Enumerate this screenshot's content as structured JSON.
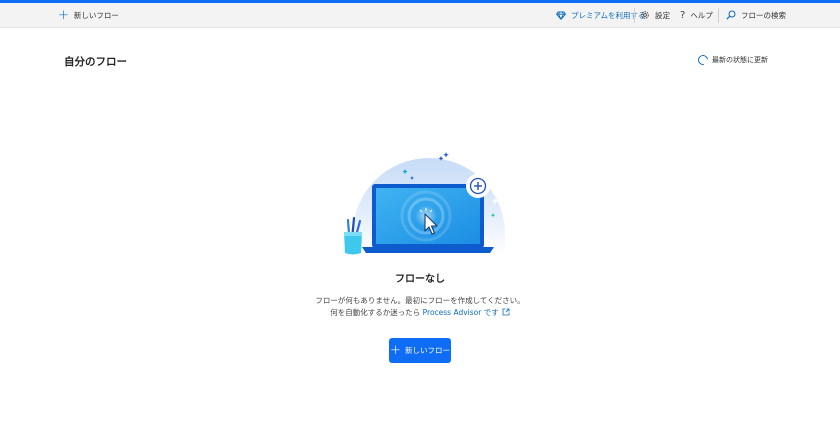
{
  "toolbar": {
    "new_flow_label": "新しいフロー",
    "premium_label": "プレミアムを利用する",
    "settings_label": "設定",
    "help_label": "ヘルプ",
    "search_label": "フローの検索"
  },
  "main": {
    "title": "自分のフロー",
    "refresh_label": "最新の状態に更新",
    "empty": {
      "title": "フローなし",
      "line1": "フローが何もありません。最初にフローを作成してください。",
      "line2_prefix": "何を自動化するか迷ったら",
      "line2_link": "Process Advisor です",
      "button_label": "新しいフロー"
    }
  },
  "colors": {
    "accent": "#0f6cf5",
    "link": "#0f6cbd",
    "toolbar_bg": "#f3f3f3"
  },
  "icons": [
    "plus-icon",
    "diamond-icon",
    "gear-icon",
    "help-icon",
    "search-icon",
    "refresh-icon",
    "external-link-icon"
  ]
}
